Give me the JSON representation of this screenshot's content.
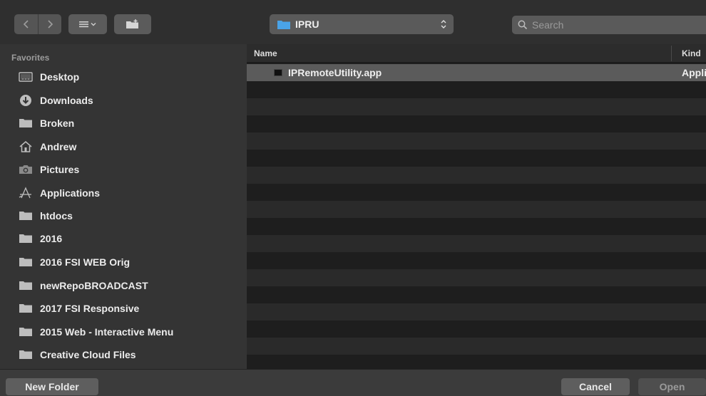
{
  "toolbar": {
    "back_icon": "chevron-left-icon",
    "forward_icon": "chevron-right-icon",
    "view_options_icon": "list-view-icon",
    "new_folder_icon": "new-folder-icon",
    "location": "IPRU",
    "search_placeholder": "Search"
  },
  "sidebar": {
    "heading": "Favorites",
    "items": [
      {
        "label": "Desktop",
        "icon": "desktop-icon"
      },
      {
        "label": "Downloads",
        "icon": "downloads-icon"
      },
      {
        "label": "Broken",
        "icon": "folder-icon"
      },
      {
        "label": "Andrew",
        "icon": "home-icon"
      },
      {
        "label": "Pictures",
        "icon": "camera-icon"
      },
      {
        "label": "Applications",
        "icon": "applications-icon"
      },
      {
        "label": "htdocs",
        "icon": "folder-icon"
      },
      {
        "label": "2016",
        "icon": "folder-icon"
      },
      {
        "label": "2016 FSI WEB Orig",
        "icon": "folder-icon"
      },
      {
        "label": "newRepoBROADCAST",
        "icon": "folder-icon"
      },
      {
        "label": "2017 FSI Responsive",
        "icon": "folder-icon"
      },
      {
        "label": "2015 Web - Interactive Menu",
        "icon": "folder-icon"
      },
      {
        "label": "Creative Cloud Files",
        "icon": "folder-icon"
      }
    ]
  },
  "filelist": {
    "columns": {
      "name": "Name",
      "kind": "Kind"
    },
    "files": [
      {
        "name": "IPRemoteUtility.app",
        "kind": "Appli",
        "icon": "app-icon"
      }
    ]
  },
  "bottombar": {
    "new_folder": "New Folder",
    "cancel": "Cancel",
    "open": "Open"
  },
  "colors": {
    "folder_blue": "#4aa3e8",
    "selected_row": "#5b5b5b",
    "sidebar_bg": "#343434",
    "list_bg": "#1e1e1e"
  }
}
